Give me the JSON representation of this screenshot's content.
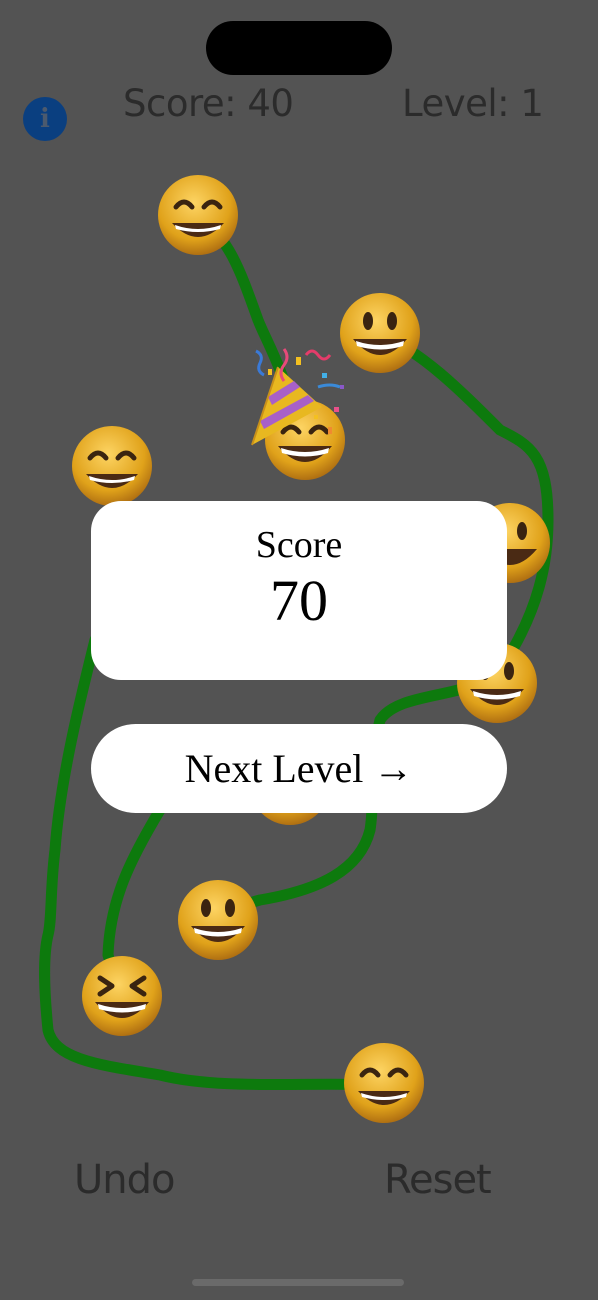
{
  "hud": {
    "info_icon": "info-icon",
    "score_label": "Score: 40",
    "level_label": "Level: 1"
  },
  "board": {
    "line_color": "#0d7a0d",
    "emojis": [
      {
        "name": "grinning-squinting-face"
      },
      {
        "name": "grinning-face"
      },
      {
        "name": "beaming-face"
      },
      {
        "name": "grinning-squinting-face"
      },
      {
        "name": "grinning-face"
      },
      {
        "name": "beaming-face"
      },
      {
        "name": "grinning-face"
      },
      {
        "name": "squinting-laughing-face"
      },
      {
        "name": "grinning-squinting-face"
      }
    ],
    "celebration_icon": "party-popper-icon"
  },
  "result": {
    "score_label": "Score",
    "score_value": "70",
    "next_button": "Next Level →"
  },
  "controls": {
    "undo": "Undo",
    "reset": "Reset"
  }
}
